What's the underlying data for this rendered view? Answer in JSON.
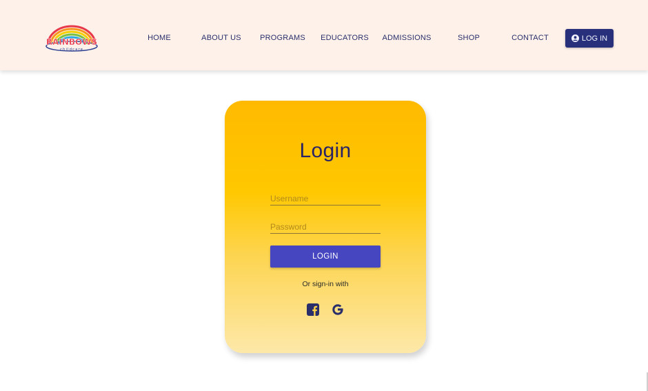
{
  "brand": {
    "logo_text": "RAINBOWS",
    "logo_subtext": "childcare"
  },
  "nav": {
    "items": [
      {
        "label": "HOME"
      },
      {
        "label": "ABOUT US"
      },
      {
        "label": "PROGRAMS"
      },
      {
        "label": "EDUCATORS"
      },
      {
        "label": "ADMISSIONS"
      },
      {
        "label": "SHOP"
      },
      {
        "label": "CONTACT"
      }
    ],
    "login_button": {
      "label": "LOG IN",
      "icon": "user-circle-icon"
    }
  },
  "login_card": {
    "title": "Login",
    "username": {
      "placeholder": "Username",
      "value": ""
    },
    "password": {
      "placeholder": "Password",
      "value": ""
    },
    "submit_label": "LOGIN",
    "alt_signin_text": "Or sign-in with",
    "social": [
      {
        "icon": "facebook-icon"
      },
      {
        "icon": "google-icon"
      }
    ]
  },
  "colors": {
    "header_bg": "#fdf1ea",
    "nav_text": "#2a2f6b",
    "login_button_bg": "#28307c",
    "card_gradient_top": "#ffba00",
    "card_gradient_bottom": "#fde8a9",
    "submit_bg": "#4646c0",
    "title_text": "#2a2466"
  }
}
